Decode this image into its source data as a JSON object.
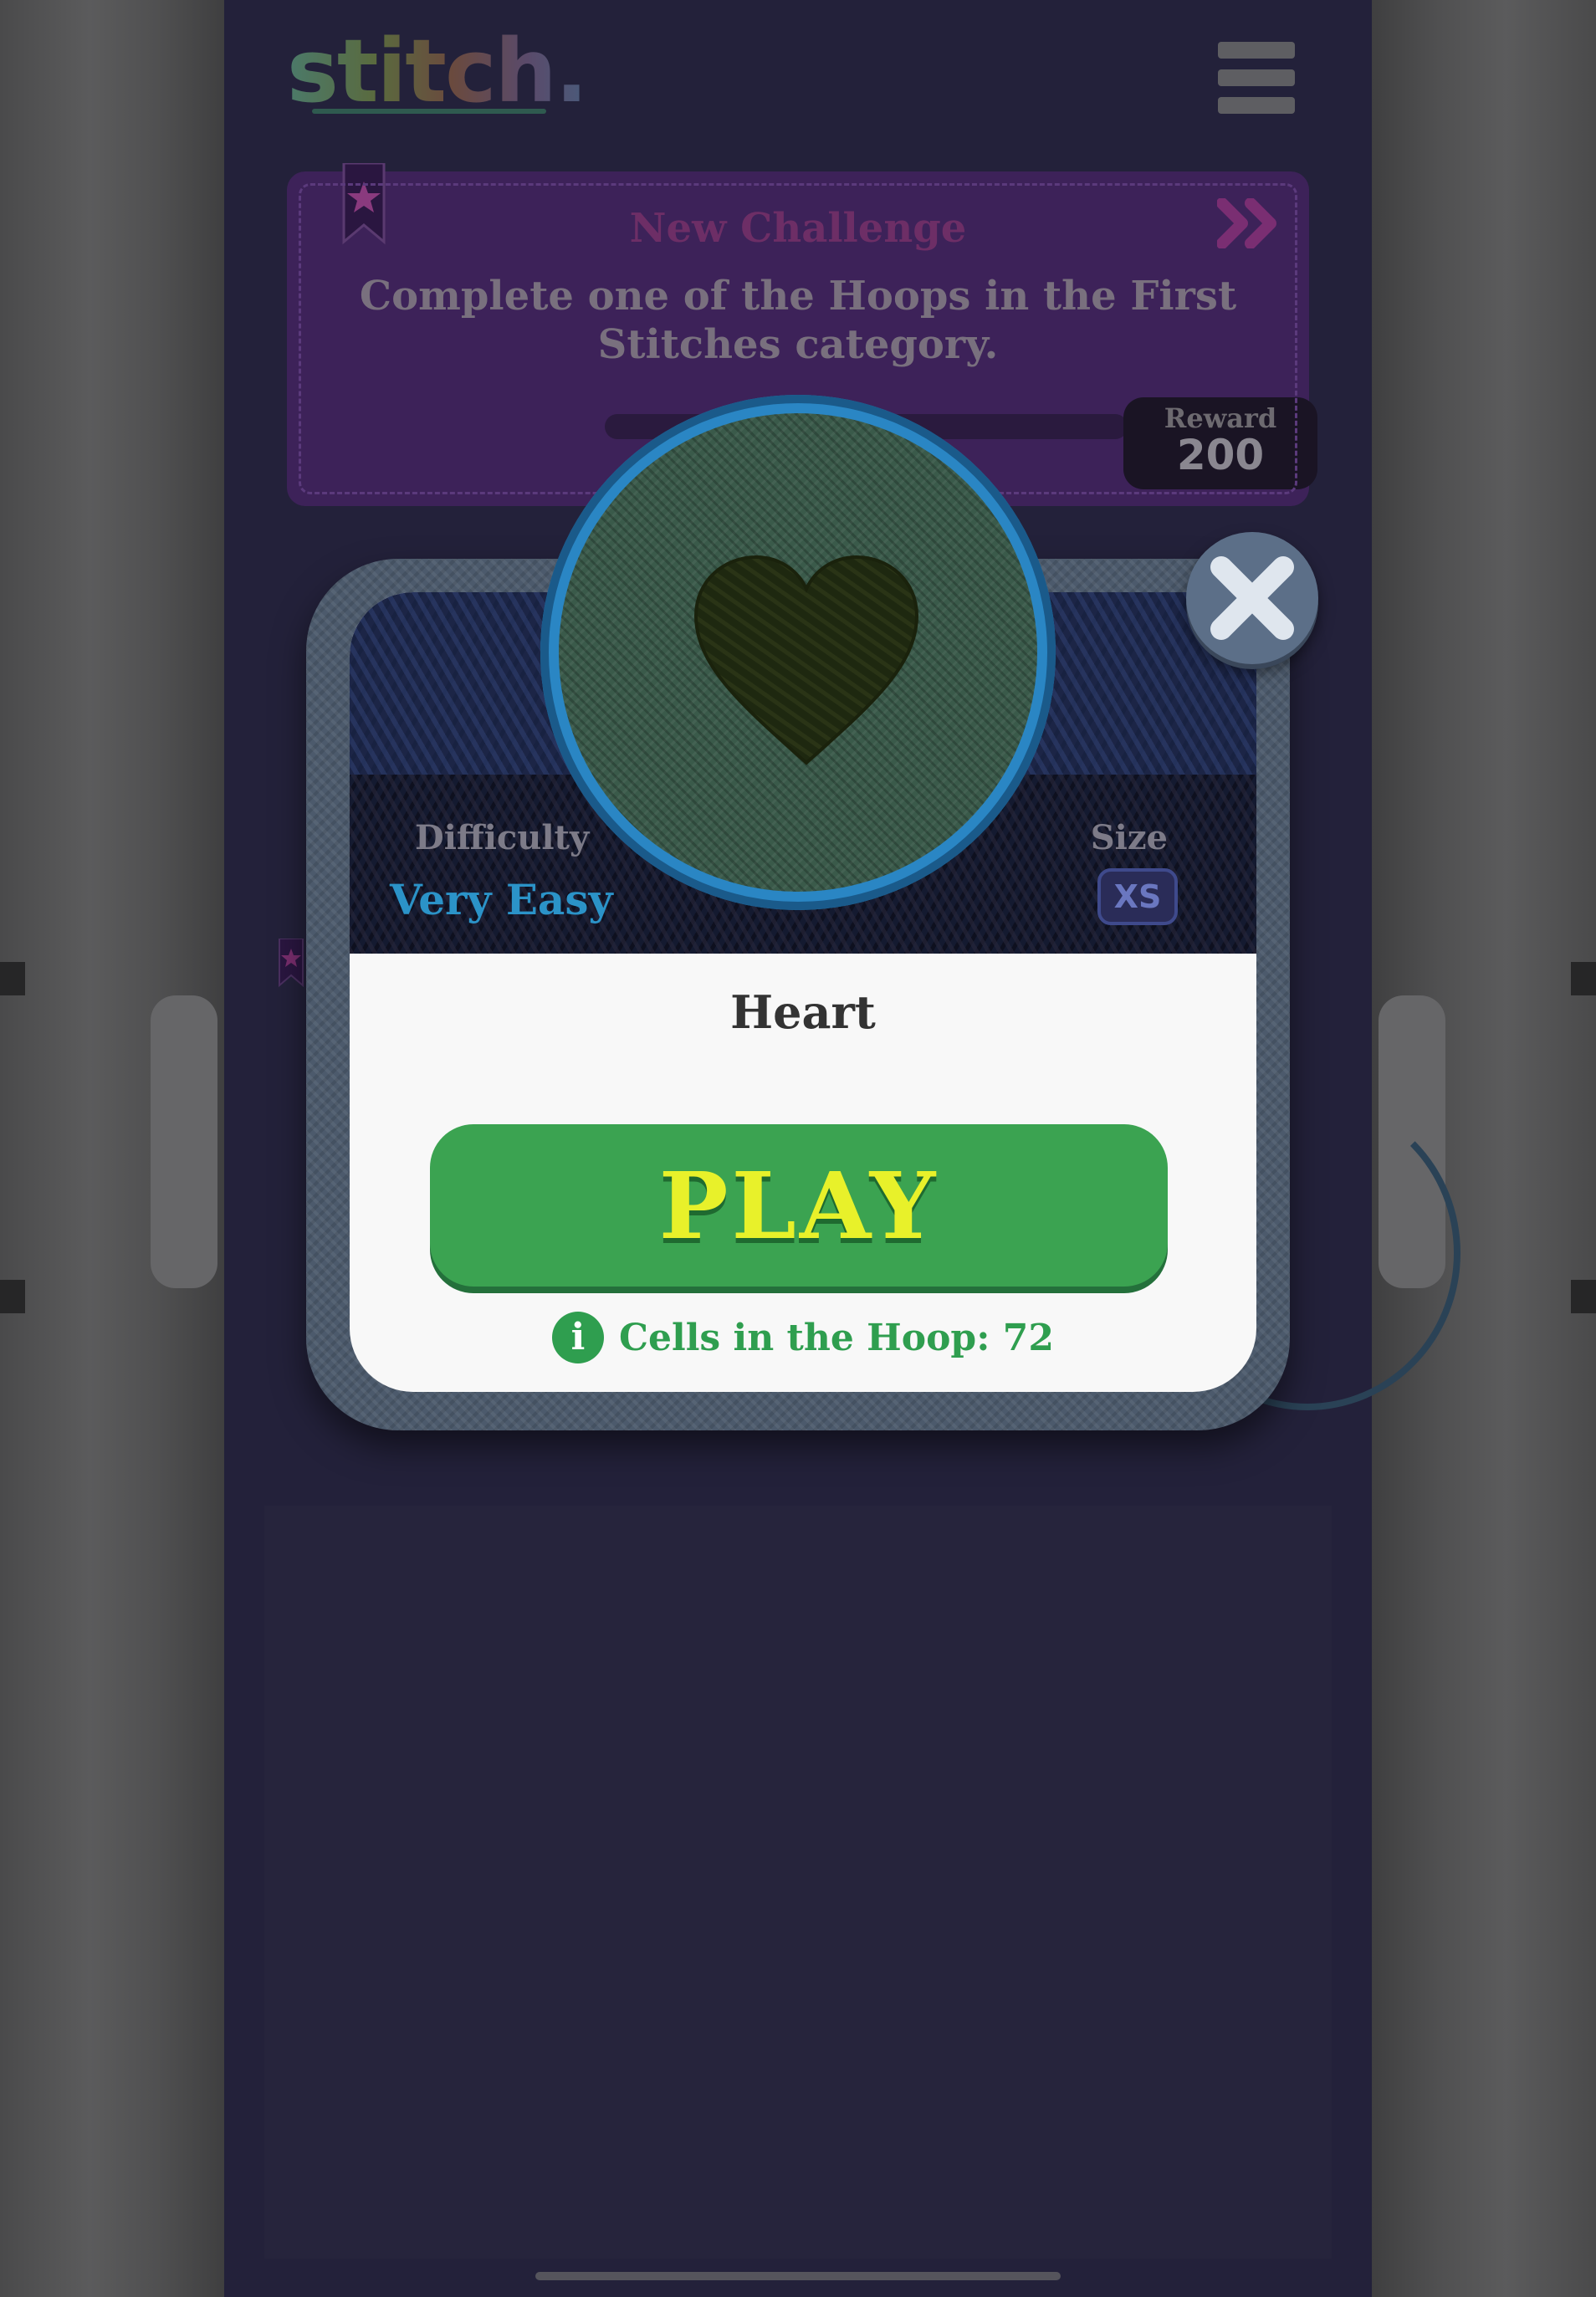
{
  "app": {
    "logo_text": "stitch."
  },
  "challenge": {
    "title": "New Challenge",
    "description": "Complete one of the Hoops in the First Stitches category.",
    "reward_label": "Reward",
    "reward_value": "200"
  },
  "modal": {
    "difficulty_label": "Difficulty",
    "difficulty_value": "Very Easy",
    "size_label": "Size",
    "size_value": "XS",
    "pattern_title": "Heart",
    "play_label": "PLAY",
    "cells_info": "Cells in the Hoop: 72"
  },
  "colors": {
    "play_button": "#3ba351",
    "play_text": "#e8f12a",
    "difficulty_text": "#2b93c8",
    "info_green": "#2f9e4f",
    "hoop_ring": "#2a86c4"
  },
  "icons": {
    "menu": "menu-icon",
    "close": "close-icon",
    "info": "info-icon",
    "bookmark": "bookmark-star-icon",
    "arrows": "double-chevron-right-icon"
  }
}
